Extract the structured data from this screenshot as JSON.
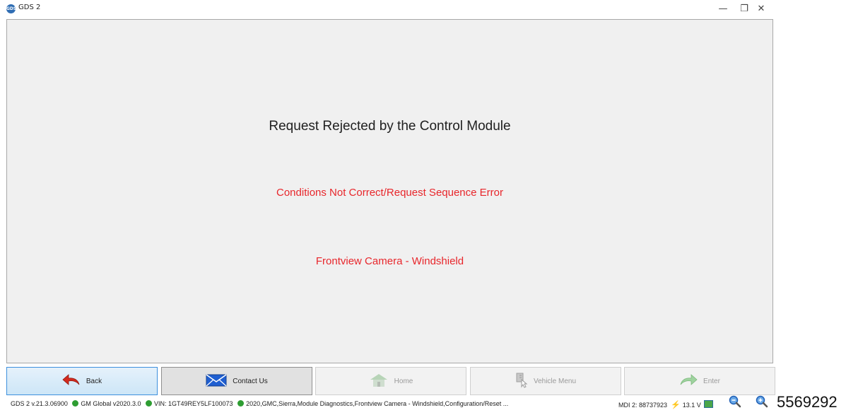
{
  "window": {
    "title": "GDS 2",
    "app_icon_text": "GDS",
    "controls": {
      "minimize": "—",
      "restore": "❐",
      "close": "✕"
    }
  },
  "message": {
    "title": "Request Rejected by the Control Module",
    "error": "Conditions Not Correct/Request Sequence Error",
    "module": "Frontview Camera - Windshield"
  },
  "buttons": {
    "back": "Back",
    "contact": "Contact Us",
    "home": "Home",
    "vehicle_menu": "Vehicle Menu",
    "enter": "Enter"
  },
  "status": {
    "version": "GDS 2 v.21.3.06900",
    "global": "GM Global v2020.3.0",
    "vin": "VIN: 1GT49REY5LF100073",
    "vehicle": "2020,GMC,Sierra,Module Diagnostics,Frontview Camera - Windshield,Configuration/Reset ...",
    "mdi": "MDI 2: 88737923",
    "voltage": "13.1 V",
    "indicator_color": "#2e9d32"
  },
  "overflow_text": "5569292"
}
